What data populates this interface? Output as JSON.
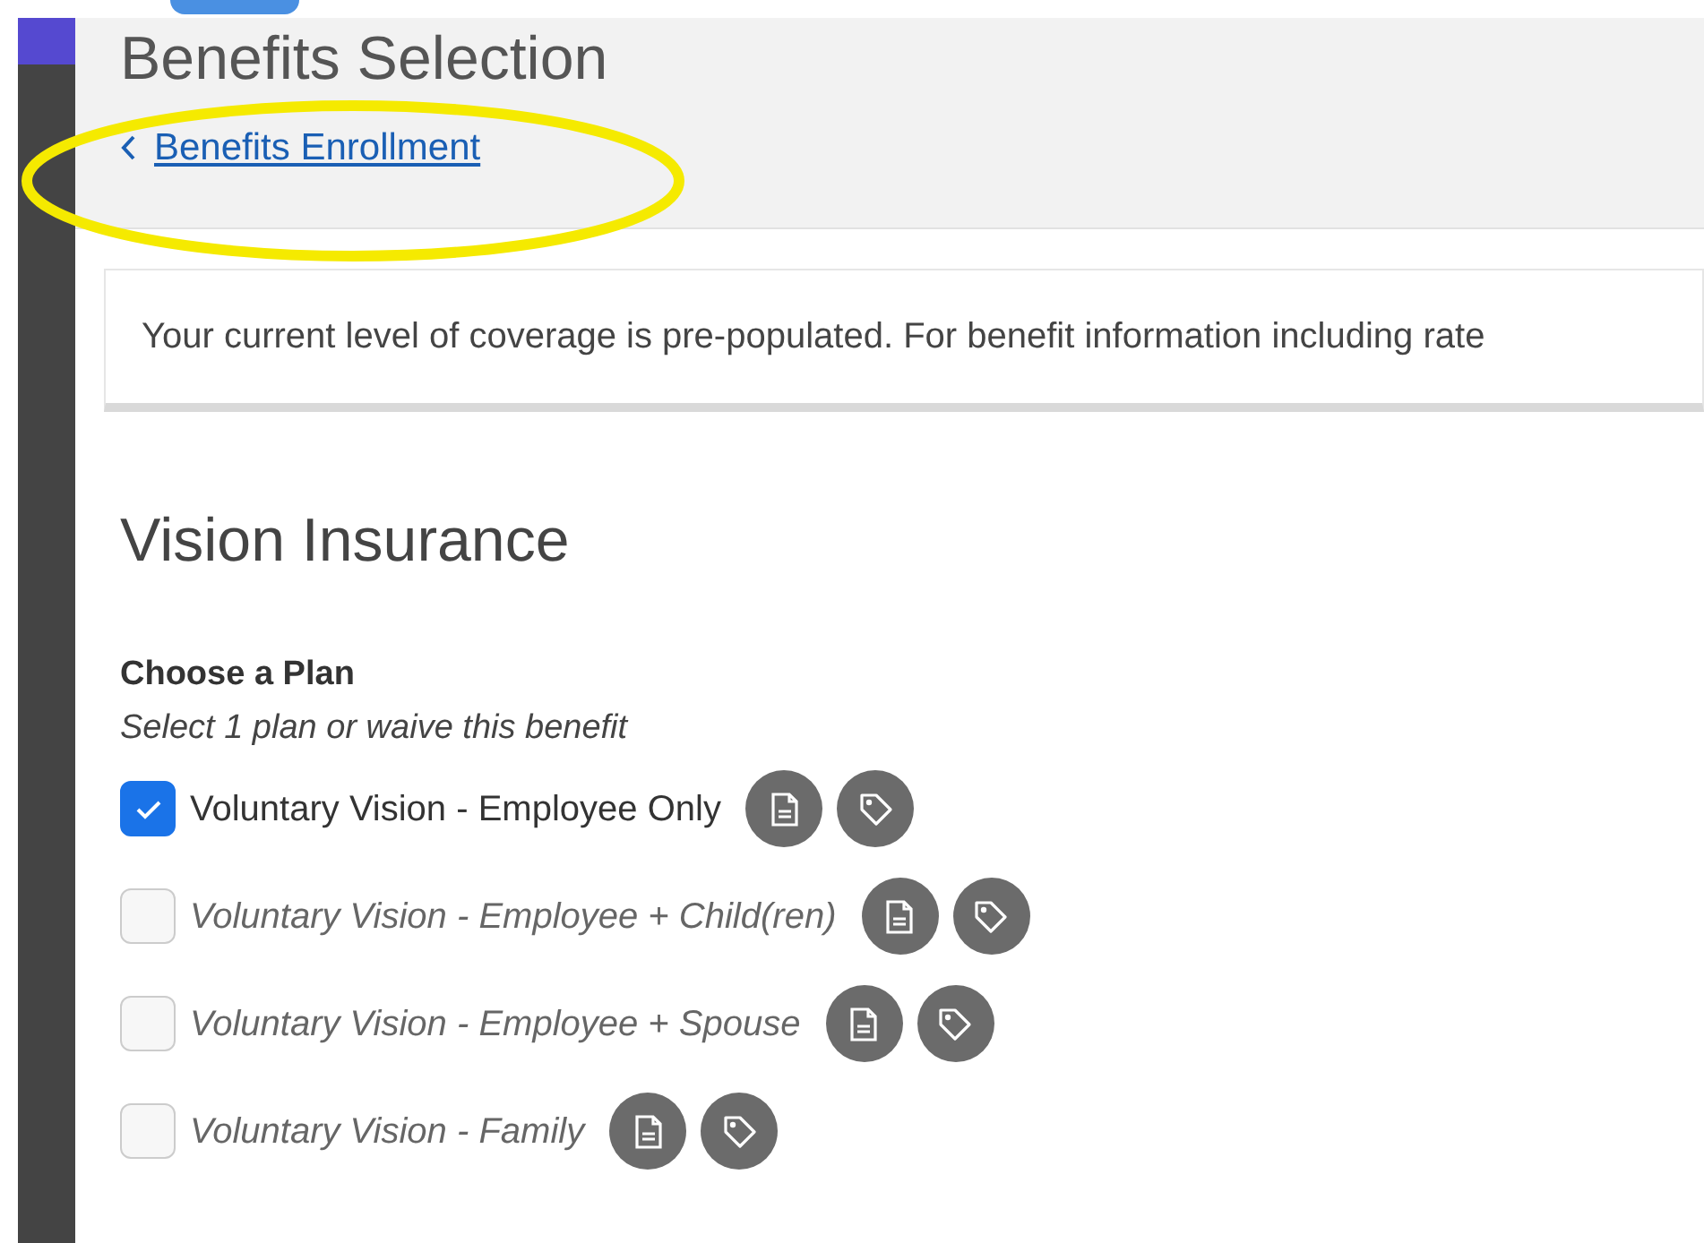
{
  "header": {
    "title": "Benefits Selection",
    "back_link": "Benefits Enrollment"
  },
  "notice": "Your current level of coverage is pre-populated. For benefit information including rate",
  "section": {
    "title": "Vision Insurance",
    "heading": "Choose a Plan",
    "hint": "Select 1 plan or waive this benefit",
    "plans": [
      {
        "label": "Voluntary Vision - Employee Only",
        "checked": true
      },
      {
        "label": "Voluntary Vision - Employee + Child(ren)",
        "checked": false
      },
      {
        "label": "Voluntary Vision - Employee + Spouse",
        "checked": false
      },
      {
        "label": "Voluntary Vision - Family",
        "checked": false
      }
    ]
  }
}
